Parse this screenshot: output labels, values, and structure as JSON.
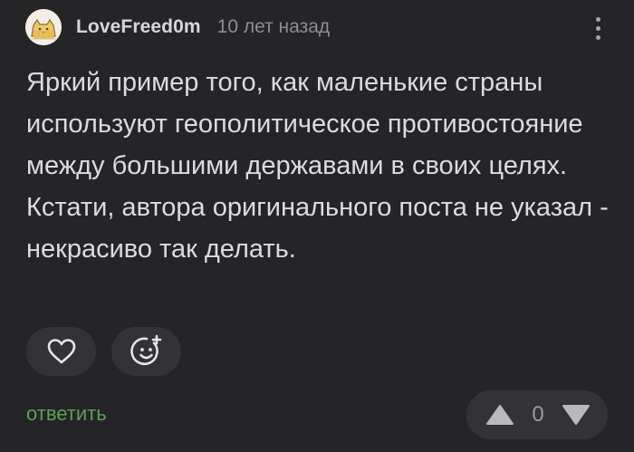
{
  "comment": {
    "author": "LoveFreed0m",
    "time": "10 лет назад",
    "text": "Яркий пример того, как маленькие страны используют геополитическое противостояние между большими державами в своих целях. Кстати, автора оригинального поста не указал - некрасиво так делать.",
    "reply_label": "ответить",
    "rating": "0"
  },
  "icons": {
    "avatar": "cat-face-avatar",
    "menu": "more-vertical-icon",
    "like": "heart-icon",
    "reaction": "add-emoji-icon",
    "upvote": "triangle-up-icon",
    "downvote": "triangle-down-icon"
  },
  "colors": {
    "background": "#252528",
    "button_bg": "#333337",
    "reply_link": "#5f9f5a",
    "text": "#dcdcde",
    "muted": "#8d8d92"
  }
}
